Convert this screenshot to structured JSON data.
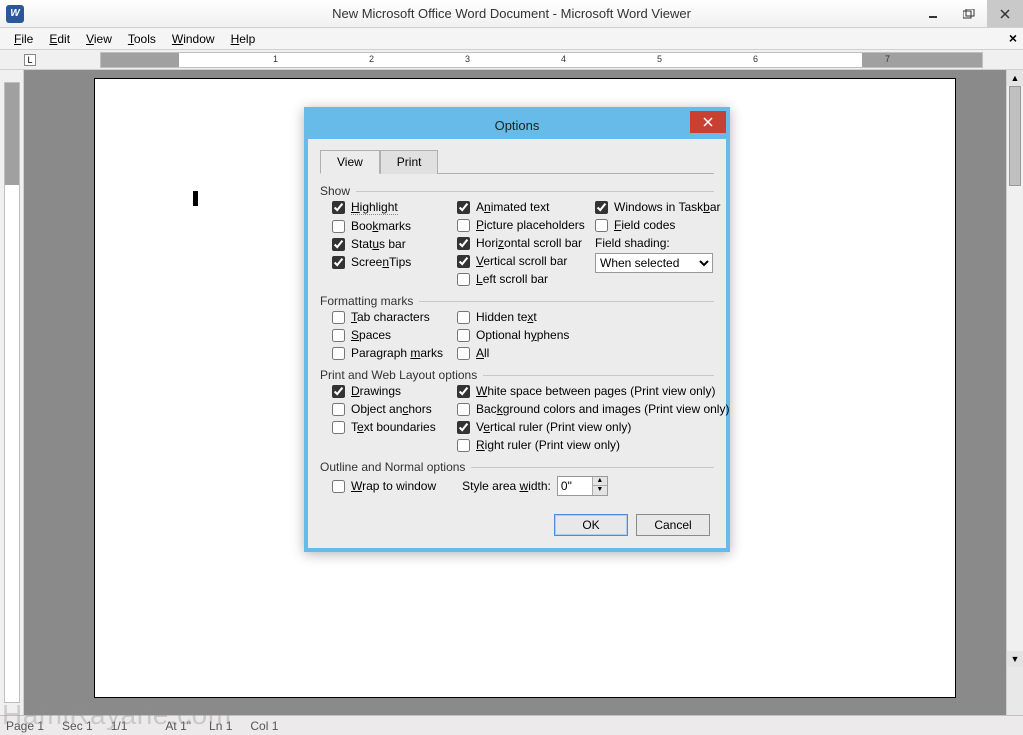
{
  "titlebar": {
    "title": "New Microsoft Office Word Document - Microsoft Word Viewer"
  },
  "menu": {
    "file": "File",
    "edit": "Edit",
    "view": "View",
    "tools": "Tools",
    "window": "Window",
    "help": "Help"
  },
  "ruler": {
    "n1": "1",
    "n2": "2",
    "n3": "3",
    "n4": "4",
    "n5": "5",
    "n6": "6",
    "n7": "7"
  },
  "statusbar": {
    "page": "Page  1",
    "sec": "Sec 1",
    "pages": "1/1",
    "at": "At  1\"",
    "ln": "Ln  1",
    "col": "Col  1"
  },
  "watermark": "HamiRayane.com",
  "dialog": {
    "title": "Options",
    "tabs": {
      "view": "View",
      "print": "Print"
    },
    "groups": {
      "show": {
        "legend": "Show",
        "highlight": "Highlight",
        "bookmarks": "Bookmarks",
        "statusbar": "Status bar",
        "screentips": "ScreenTips",
        "animated": "Animated text",
        "picture": "Picture placeholders",
        "hscroll": "Horizontal scroll bar",
        "vscroll": "Vertical scroll bar",
        "lscroll": "Left scroll bar",
        "wintask": "Windows in Taskbar",
        "fieldcodes": "Field codes",
        "fieldshading_label": "Field shading:",
        "fieldshading_value": "When selected"
      },
      "fmt": {
        "legend": "Formatting marks",
        "tab": "Tab characters",
        "spaces": "Spaces",
        "para": "Paragraph marks",
        "hidden": "Hidden text",
        "hyphen": "Optional hyphens",
        "all": "All"
      },
      "pweb": {
        "legend": "Print and Web Layout options",
        "drawings": "Drawings",
        "anchors": "Object anchors",
        "textbound": "Text boundaries",
        "whitespace": "White space between pages (Print view only)",
        "bgcolors": "Background colors and images (Print view only)",
        "vruler": "Vertical ruler (Print view only)",
        "rruler": "Right ruler (Print view only)"
      },
      "outline": {
        "legend": "Outline and Normal options",
        "wrap": "Wrap to window",
        "stylewidth_label": "Style area width:",
        "stylewidth_value": "0\""
      }
    },
    "buttons": {
      "ok": "OK",
      "cancel": "Cancel"
    }
  }
}
